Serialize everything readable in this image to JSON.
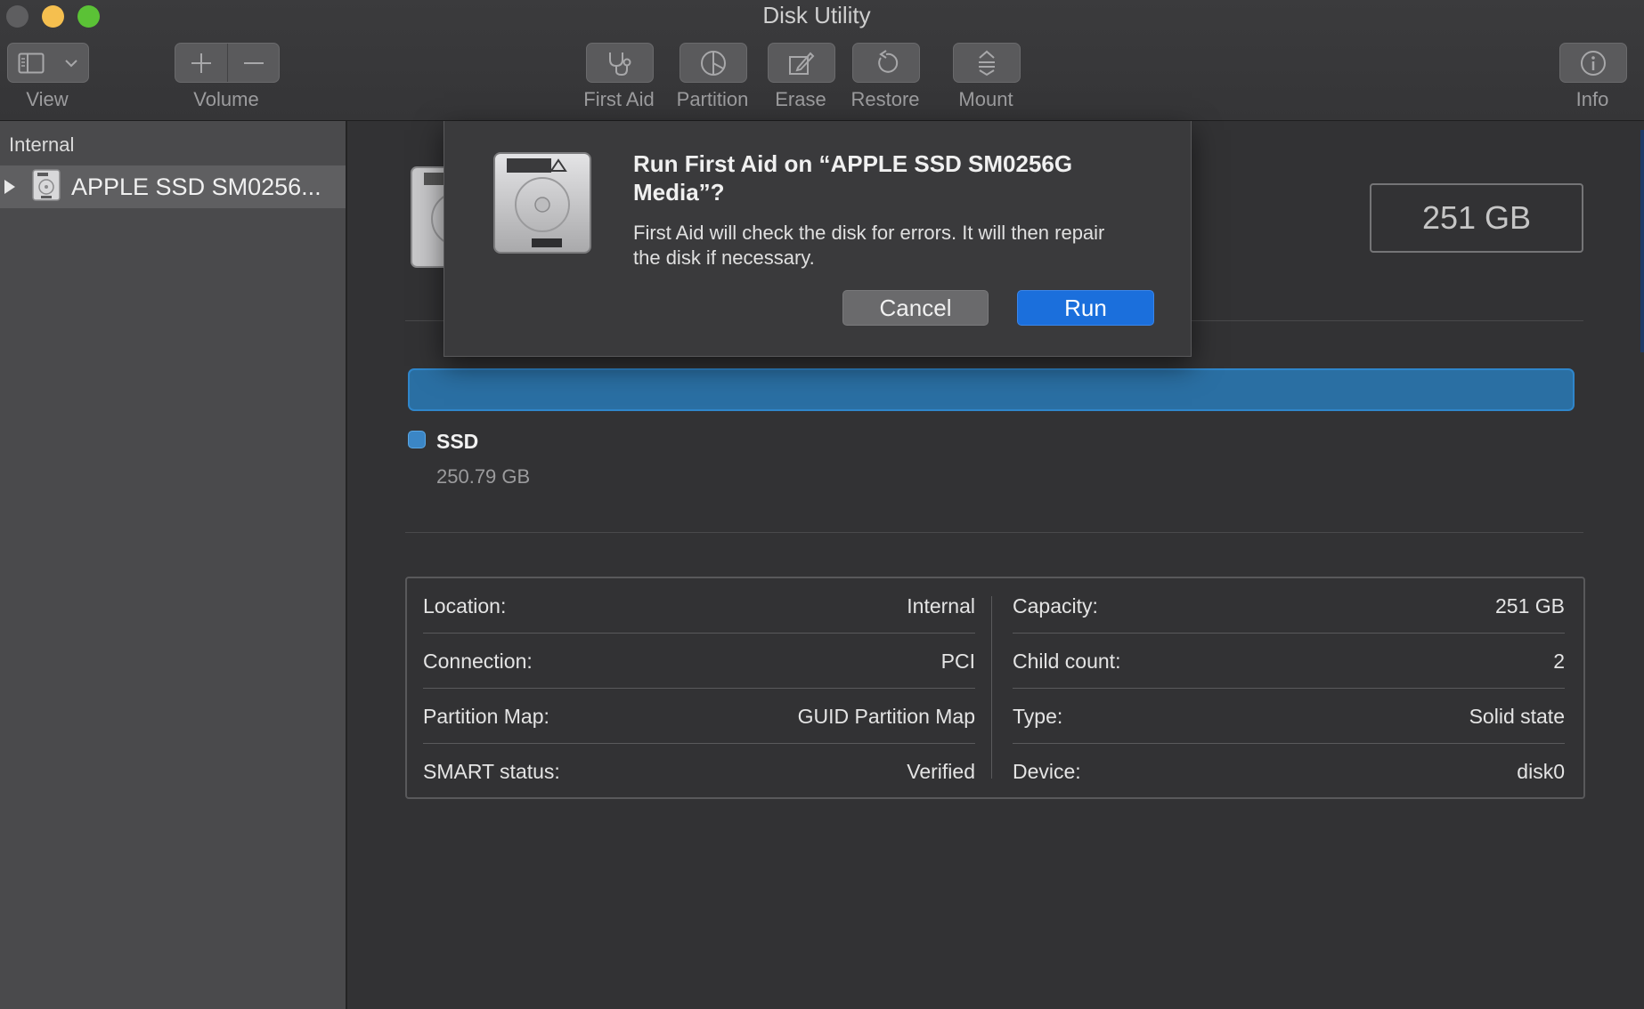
{
  "window": {
    "title": "Disk Utility",
    "colors": {
      "close": "#5e5e60",
      "minimize": "#f5bf4f",
      "maximize": "#5bc236",
      "accent": "#1b6fdc"
    }
  },
  "toolbar": {
    "view_label": "View",
    "volume_label": "Volume",
    "first_aid_label": "First Aid",
    "partition_label": "Partition",
    "erase_label": "Erase",
    "restore_label": "Restore",
    "mount_label": "Mount",
    "info_label": "Info",
    "icons": {
      "view": "sidebar-icon",
      "add": "plus-icon",
      "remove": "minus-icon",
      "first_aid": "stethoscope-icon",
      "partition": "pie-icon",
      "erase": "pencil-icon",
      "restore": "undo-icon",
      "mount": "eject-icon",
      "info": "info-icon"
    }
  },
  "sidebar": {
    "section": "Internal",
    "items": [
      {
        "label": "APPLE SSD SM0256...",
        "icon": "hard-disk-icon",
        "selected": true
      }
    ]
  },
  "main": {
    "capacity": "251 GB",
    "usage": {
      "color": "#2a6fa3",
      "name": "SSD",
      "size": "250.79 GB"
    },
    "info": {
      "left": [
        {
          "label": "Location:",
          "value": "Internal"
        },
        {
          "label": "Connection:",
          "value": "PCI"
        },
        {
          "label": "Partition Map:",
          "value": "GUID Partition Map"
        },
        {
          "label": "SMART status:",
          "value": "Verified"
        }
      ],
      "right": [
        {
          "label": "Capacity:",
          "value": "251 GB"
        },
        {
          "label": "Child count:",
          "value": "2"
        },
        {
          "label": "Type:",
          "value": "Solid state"
        },
        {
          "label": "Device:",
          "value": "disk0"
        }
      ]
    }
  },
  "dialog": {
    "title": "Run First Aid on “APPLE SSD SM0256G Media”?",
    "message": "First Aid will check the disk for errors. It will then repair the disk if necessary.",
    "cancel_label": "Cancel",
    "run_label": "Run",
    "icon": "hard-disk-icon"
  }
}
